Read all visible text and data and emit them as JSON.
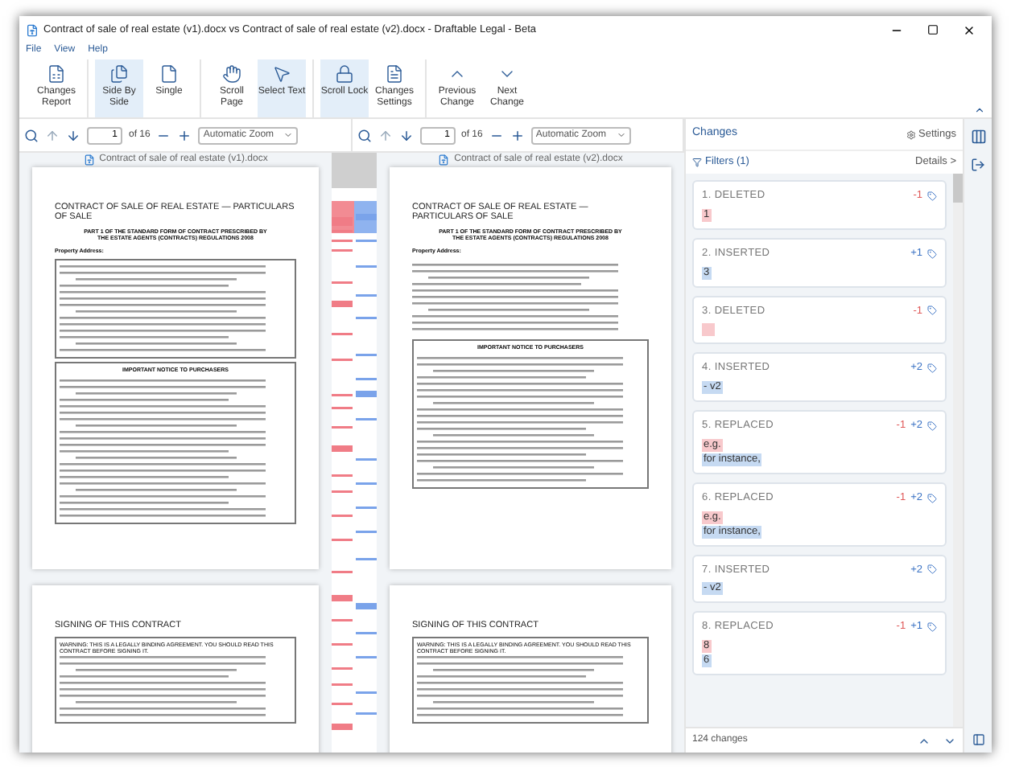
{
  "window": {
    "title": "Contract of sale of real estate (v1).docx vs Contract of sale of real estate (v2).docx - Draftable Legal - Beta"
  },
  "menu": [
    "File",
    "View",
    "Help"
  ],
  "toolbar_groups": [
    [
      {
        "label": "Changes Report",
        "selected": false
      }
    ],
    [
      {
        "label": "Side By Side",
        "selected": true
      },
      {
        "label": "Single",
        "selected": false
      }
    ],
    [
      {
        "label": "Scroll Page",
        "selected": false
      },
      {
        "label": "Select Text",
        "selected": true
      }
    ],
    [
      {
        "label": "Scroll Lock",
        "selected": true
      },
      {
        "label": "Changes Settings",
        "selected": false
      }
    ],
    [
      {
        "label": "Previous Change",
        "selected": false
      },
      {
        "label": "Next Change",
        "selected": false
      }
    ]
  ],
  "panes": [
    {
      "page": "1",
      "page_count": "of 16",
      "zoom": "Automatic Zoom",
      "file_name": "Contract of sale of real estate (v1).docx",
      "pages": [
        {
          "title": "CONTRACT OF SALE OF REAL ESTATE — PARTICULARS OF SALE",
          "subtitle": "PART 1 OF THE STANDARD FORM OF CONTRACT PRESCRIBED BY THE ESTATE AGENTS (CONTRACTS) REGULATIONS 2008",
          "label": "Property Address:",
          "boxes": [
            {
              "heading": "IMPORTANT NOTICE TO PURCHASERS"
            }
          ]
        },
        {
          "title": "SIGNING OF THIS CONTRACT",
          "boxes": [
            {
              "text": "WARNING: THIS IS A LEGALLY BINDING AGREEMENT. YOU SHOULD READ THIS CONTRACT BEFORE SIGNING IT."
            }
          ]
        }
      ]
    },
    {
      "page": "1",
      "page_count": "of 16",
      "zoom": "Automatic Zoom",
      "file_name": "Contract of sale of real estate (v2).docx",
      "pages": [
        {
          "title": "CONTRACT OF SALE OF REAL ESTATE — PARTICULARS OF SALE",
          "subtitle": "PART 1 OF THE STANDARD FORM OF CONTRACT PRESCRIBED BY THE ESTATE AGENTS (CONTRACTS) REGULATIONS 2008",
          "label": "Property Address:",
          "boxes": [
            {
              "heading": "IMPORTANT NOTICE TO PURCHASERS"
            }
          ]
        },
        {
          "title": "SIGNING OF THIS CONTRACT",
          "boxes": [
            {
              "text": "WARNING: THIS IS A LEGALLY BINDING AGREEMENT. YOU SHOULD READ THIS CONTRACT BEFORE SIGNING IT."
            }
          ]
        }
      ]
    }
  ],
  "changes": {
    "title": "Changes",
    "settings": "Settings",
    "filters": "Filters (1)",
    "details": "Details >",
    "count": "124 changes",
    "items": [
      {
        "kind": "deleted",
        "heading": "1. DELETED",
        "removed": "-1",
        "deleted": "1"
      },
      {
        "kind": "inserted",
        "heading": "2. INSERTED",
        "added": "+1",
        "inserted": "3"
      },
      {
        "kind": "deleted",
        "heading": "3. DELETED",
        "removed": "-1"
      },
      {
        "kind": "inserted",
        "heading": "4. INSERTED",
        "added": "+2",
        "inserted": "- v2"
      },
      {
        "kind": "replaced",
        "heading": "5. REPLACED",
        "removed": "-1",
        "added": "+2",
        "deleted": "e.g.",
        "inserted": "for instance,"
      },
      {
        "kind": "replaced",
        "heading": "6. REPLACED",
        "removed": "-1",
        "added": "+2",
        "deleted": "e.g.",
        "inserted": "for instance,"
      },
      {
        "kind": "inserted",
        "heading": "7. INSERTED",
        "added": "+2",
        "inserted": "- v2"
      },
      {
        "kind": "replaced",
        "heading": "8. REPLACED",
        "removed": "-1",
        "added": "+1",
        "deleted": "8",
        "inserted": "6"
      }
    ]
  }
}
